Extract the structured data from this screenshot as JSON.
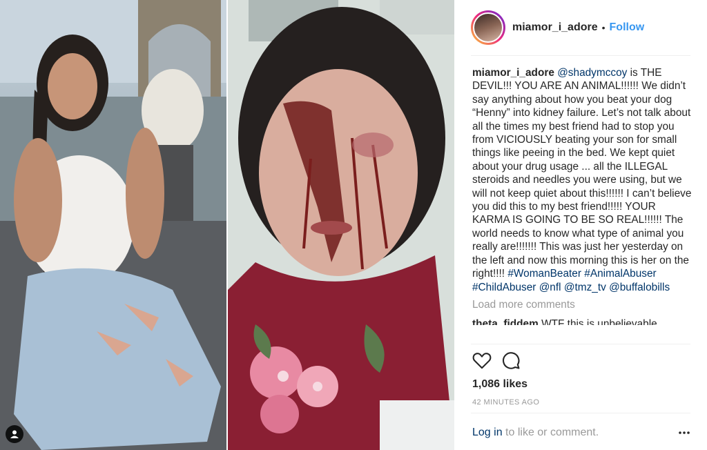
{
  "post": {
    "username": "miamor_i_adore",
    "separator": "•",
    "follow_label": "Follow"
  },
  "caption": {
    "author": "miamor_i_adore",
    "mention": "@shadymccoy",
    "text_1": " is THE DEVIL!!! YOU ARE AN ANIMAL!!!!!! We didn’t say anything about how you beat your dog “Henny” into kidney failure. Let’s not talk about all the times my best friend had to stop you from VICIOUSLY beating your son for small things like peeing in the bed. We kept quiet about your drug usage ... all the ILLEGAL steroids and needles you were using, but we will not keep quiet about this!!!!!! I can’t believe you did this to my best friend!!!!! YOUR KARMA IS GOING TO BE SO REAL!!!!!! The world needs to know what type of animal you really are!!!!!!! This was just her yesterday on the left and now this morning this is her on the right!!!!",
    "tags": [
      "#WomanBeater",
      "#AnimalAbuser",
      "#ChildAbuser",
      "@nfl",
      "@tmz_tv",
      "@buffalobills"
    ]
  },
  "load_more_label": "Load more comments",
  "partial_comment": {
    "author": "theta_fiddem",
    "text": "WTF this is unbelievable"
  },
  "icons": {
    "like": "heart-icon",
    "comment": "comment-icon",
    "user_tag": "user-tag-icon",
    "more": "more-options-icon"
  },
  "likes_label": "1,086 likes",
  "timestamp": "42 MINUTES AGO",
  "footer": {
    "login_label": "Log in",
    "rest": " to like or comment."
  },
  "colors": {
    "follow": "#3897f0",
    "link": "#003569",
    "muted": "#999999"
  }
}
